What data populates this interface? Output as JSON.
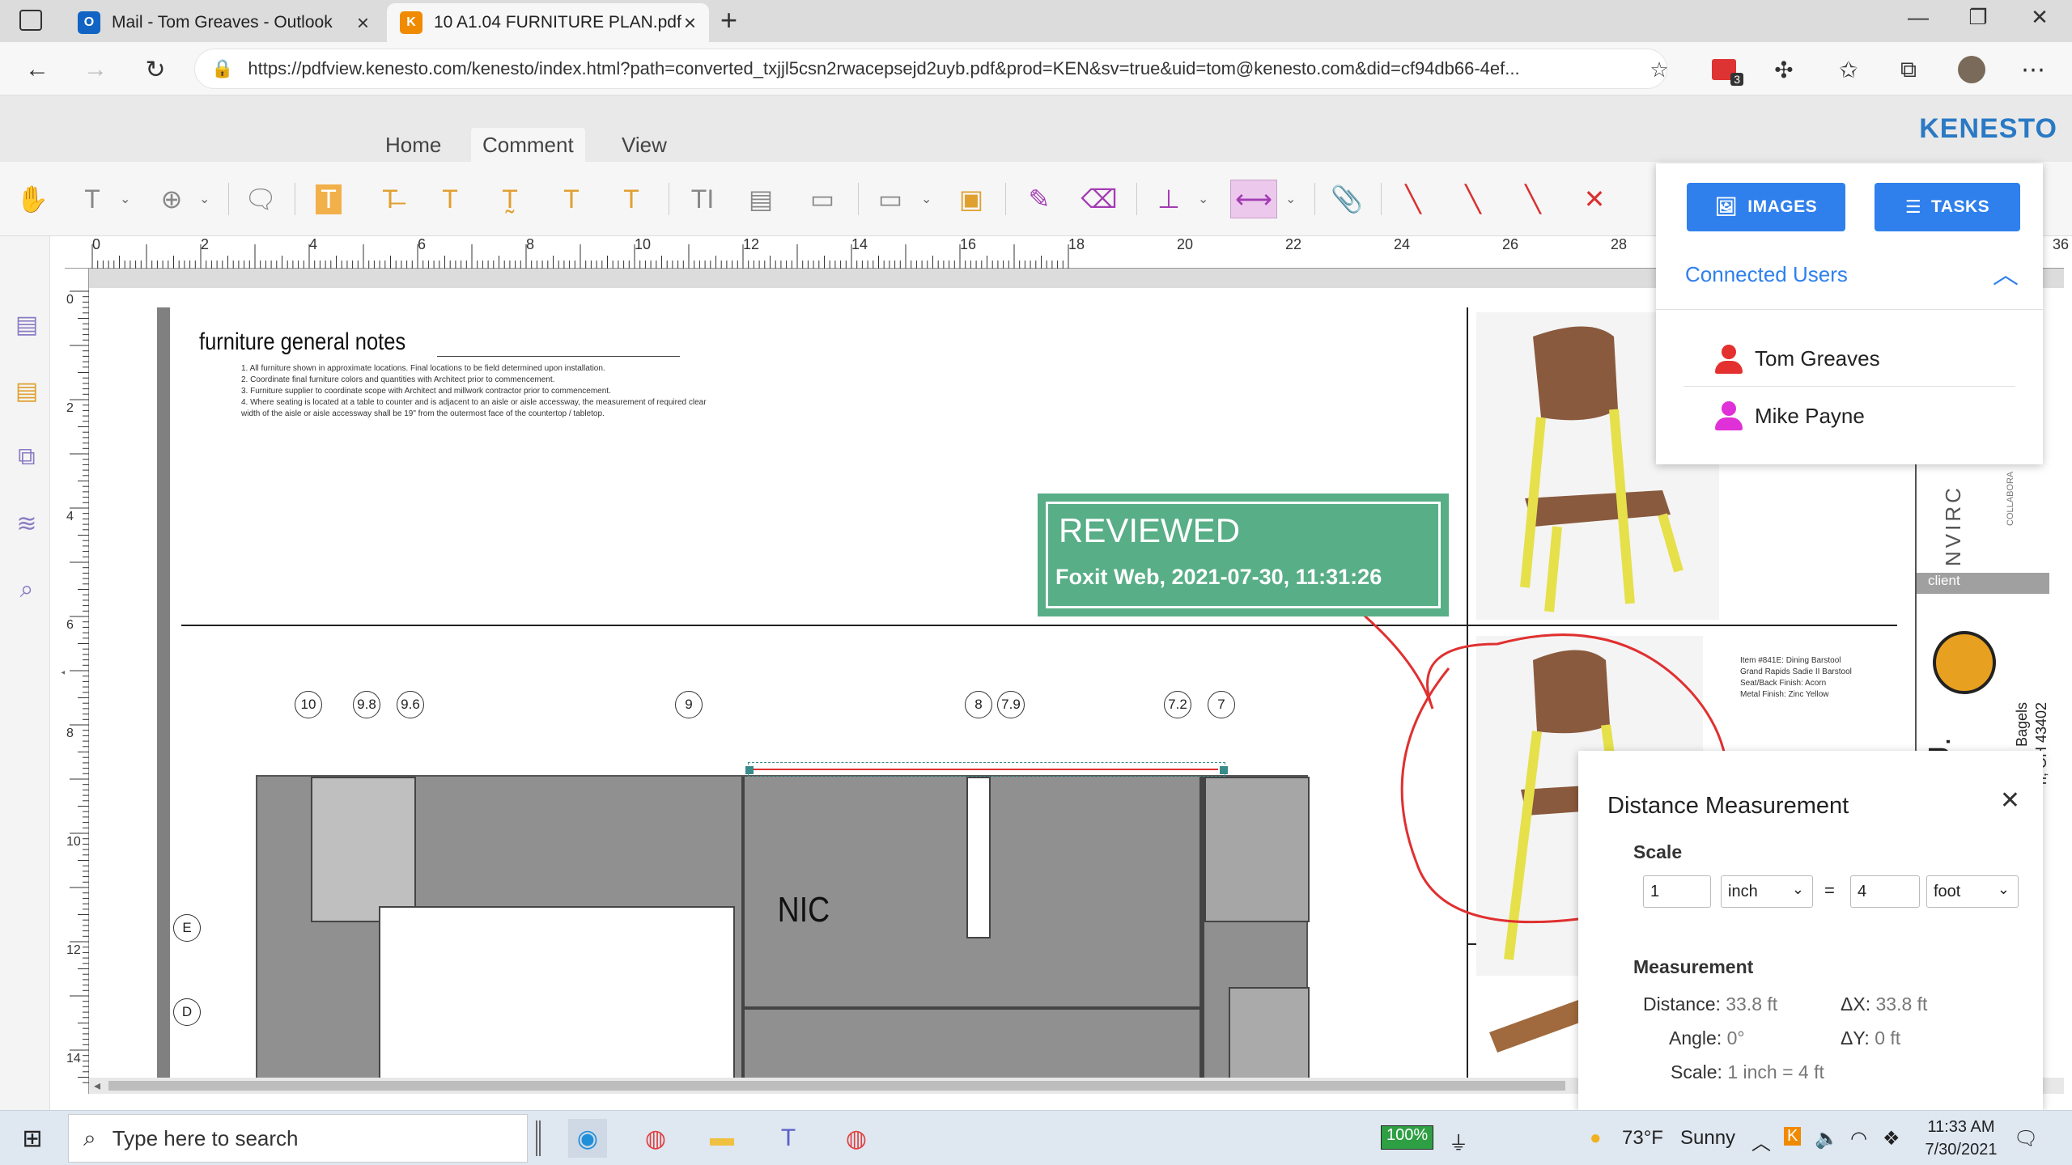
{
  "browser": {
    "tabs": [
      {
        "title": "Mail - Tom Greaves - Outlook",
        "icon": "O",
        "color": "#1164c4"
      },
      {
        "title": "10 A1.04 FURNITURE PLAN.pdf",
        "icon": "K",
        "color": "#f08a00"
      }
    ],
    "url": "https://pdfview.kenesto.com/kenesto/index.html?path=converted_txjjl5csn2rwacepsejd2uyb.pdf&prod=KEN&sv=true&uid=tom@kenesto.com&did=cf94db66-4ef...",
    "extension_badge": "3"
  },
  "app": {
    "menu": [
      "Home",
      "Comment",
      "View"
    ],
    "active_menu": "Comment",
    "logo": "KENESTO"
  },
  "ruler": {
    "h_ticks": [
      "0",
      "2",
      "4",
      "6",
      "8",
      "10",
      "12",
      "14",
      "16",
      "18",
      "20",
      "22",
      "24",
      "26",
      "28",
      "36"
    ],
    "v_ticks": [
      "0",
      "2",
      "4",
      "6",
      "8",
      "10",
      "12",
      "14"
    ]
  },
  "document": {
    "notes_title": "furniture general notes",
    "notes": [
      "1.   All furniture shown in approximate locations. Final locations to be field determined upon installation.",
      "2.   Coordinate final furniture colors and quantities with Architect prior to commencement.",
      "3.   Furniture supplier to coordinate scope with Architect and millwork contractor prior to commencement.",
      "4.   Where seating is located at a table to counter and is adjacent to an aisle or aisle accessway, the measurement of required clear",
      "     width of the aisle or aisle accessway shall be 19\" from the outermost face of the countertop / tabletop."
    ],
    "stamp": {
      "title": "REVIEWED",
      "subtitle": "Foxit Web, 2021-07-30, 11:31:26"
    },
    "grid_bubbles": [
      "10",
      "9.8",
      "9.6",
      "9",
      "8",
      "7.9",
      "7.2",
      "7",
      "E",
      "D"
    ],
    "room_label": "NIC",
    "item_note": [
      "Item #841E: Dining Barstool",
      "Grand Rapids Sadie II Barstool",
      "Seat/Back Finish: Acorn",
      "Metal Finish: Zinc Yellow"
    ],
    "title_block": {
      "nvirc": "NVIRC",
      "collab": "COLLABORA",
      "client": "client",
      "bagels1": "Bros. Bagels",
      "bagels2": "n, OH 43402",
      "esu": "ESU."
    }
  },
  "panel": {
    "images_btn": "IMAGES",
    "tasks_btn": "TASKS",
    "connected_title": "Connected Users",
    "users": [
      {
        "name": "Tom Greaves",
        "color": "#e53030"
      },
      {
        "name": "Mike Payne",
        "color": "#e030d8"
      }
    ]
  },
  "measure": {
    "title": "Distance Measurement",
    "scale_label": "Scale",
    "scale_from": "1",
    "scale_from_unit": "inch",
    "equals": "=",
    "scale_to": "4",
    "scale_to_unit": "foot",
    "measurement_label": "Measurement",
    "distance_label": "Distance:",
    "distance_value": "33.8 ft",
    "dx_label": "ΔX:",
    "dx_value": "33.8 ft",
    "angle_label": "Angle:",
    "angle_value": "0°",
    "dy_label": "ΔY:",
    "dy_value": "0 ft",
    "scale_row_label": "Scale:",
    "scale_row_value": "1 inch = 4 ft"
  },
  "taskbar": {
    "search_placeholder": "Type here to search",
    "battery": "100%",
    "weather_temp": "73°F",
    "weather_cond": "Sunny",
    "time": "11:33 AM",
    "date": "7/30/2021"
  }
}
